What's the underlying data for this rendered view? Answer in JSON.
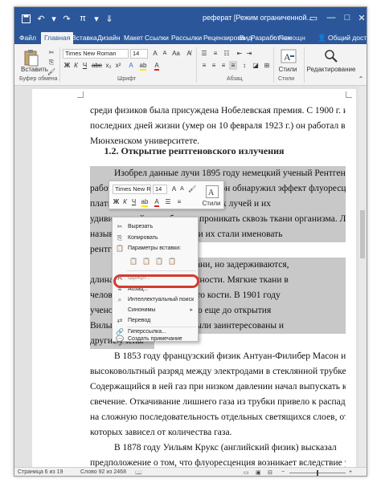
{
  "app": {
    "title": "реферат [Режим ограниченной...",
    "qa_icons": [
      "save-icon",
      "undo-icon",
      "redo-icon",
      "pi-icon",
      "customize-icon"
    ]
  },
  "tabs": [
    "Файл",
    "Главная",
    "Вставка",
    "Дизайн",
    "Макет",
    "Ссылки",
    "Рассылки",
    "Рецензирова",
    "Вид",
    "Разработчик"
  ],
  "active_tab": "Главная",
  "help_label": "♀ Помощн",
  "share_label": "Общий доступ",
  "ribbon": {
    "paste_label": "Вставить",
    "font_name": "Times New Roman",
    "font_size": "14",
    "bold": "Ж",
    "italic": "К",
    "underline": "Ч",
    "styles_label": "Стили",
    "editing_label": "Редактирование",
    "groups": {
      "clipboard": "Буфер обмена",
      "font": "Шрифт",
      "paragraph": "Абзац",
      "styles": "Стили"
    }
  },
  "document": {
    "para1": [
      "среди физиков была присуждена Нобелевская премия. С 1900 г. и до",
      "последних дней жизни (умер он 10 февраля 1923 г.) он работал в",
      "Мюнхенском университете."
    ],
    "heading": "1.2. Открытие рентгеновского излучения",
    "para2": [
      "Изобрел данные лучи 1895 году немецкий ученый Рентген: во время",
      "работы с катодолучевой трубкой он обнаружил эффект флуоресценции",
      "платино-циан                                   шло описание таких лучей и их",
      "удивительной способности проникать сквозь ткани организма. Лучи стали",
      "называться р                    позже в России их стали именовать",
      "рентгеновски"
    ],
    "para3": [
      "Лучи с                                   озь мягкие ткани, но задерживаются,",
      "длина их ол                               твердой поверхности. Мягкие ткани в",
      "человеческо                                а твердые — это кости. В 1901 году",
      "ученому при                               ремию. Однако еще до открытия",
      "Вильгельма                                обной темой были заинтересованы и",
      "другие учены"
    ],
    "para4": [
      "В 1853 году французский физик Антуан-Филибер Масон изучал",
      "высоковольтный разряд между электродами в стеклянной трубке.",
      "Содержащийся в ней газ при низком давлении начал выпускать красноватое",
      "свечение. Откачивание лишнего газа из трубки привело к распаду свечения",
      "на сложную последовательность отдельных светящихся слоев, оттенок",
      "которых зависел от количества газа."
    ],
    "para5": [
      "В 1878 году Уильям Крукс (английский физик) высказал",
      "предположение о том, что флуоресценция возникает вследствие удара"
    ]
  },
  "mini_toolbar": {
    "font_name": "Times New Rc",
    "font_size": "14",
    "bold": "Ж",
    "italic": "К",
    "underline": "Ч",
    "styles_label": "Стили"
  },
  "context_menu": {
    "cut": "Вырезать",
    "copy": "Копировать",
    "paste_options": "Параметры вставки:",
    "font": "Шрифт...",
    "paragraph": "Абзац...",
    "smart_lookup": "Интеллектуальный поиск",
    "synonyms": "Синонимы",
    "translate": "Перевод",
    "hyperlink": "Гиперссылка...",
    "new_comment": "Создать примечание"
  },
  "status": {
    "page": "Страница 6 из 19",
    "words": "Слово 92 из 2468",
    "zoom": "+"
  },
  "colors": {
    "accent": "#2b579a",
    "highlight_ring": "#d63a2f",
    "selection": "#c8c8c8"
  }
}
